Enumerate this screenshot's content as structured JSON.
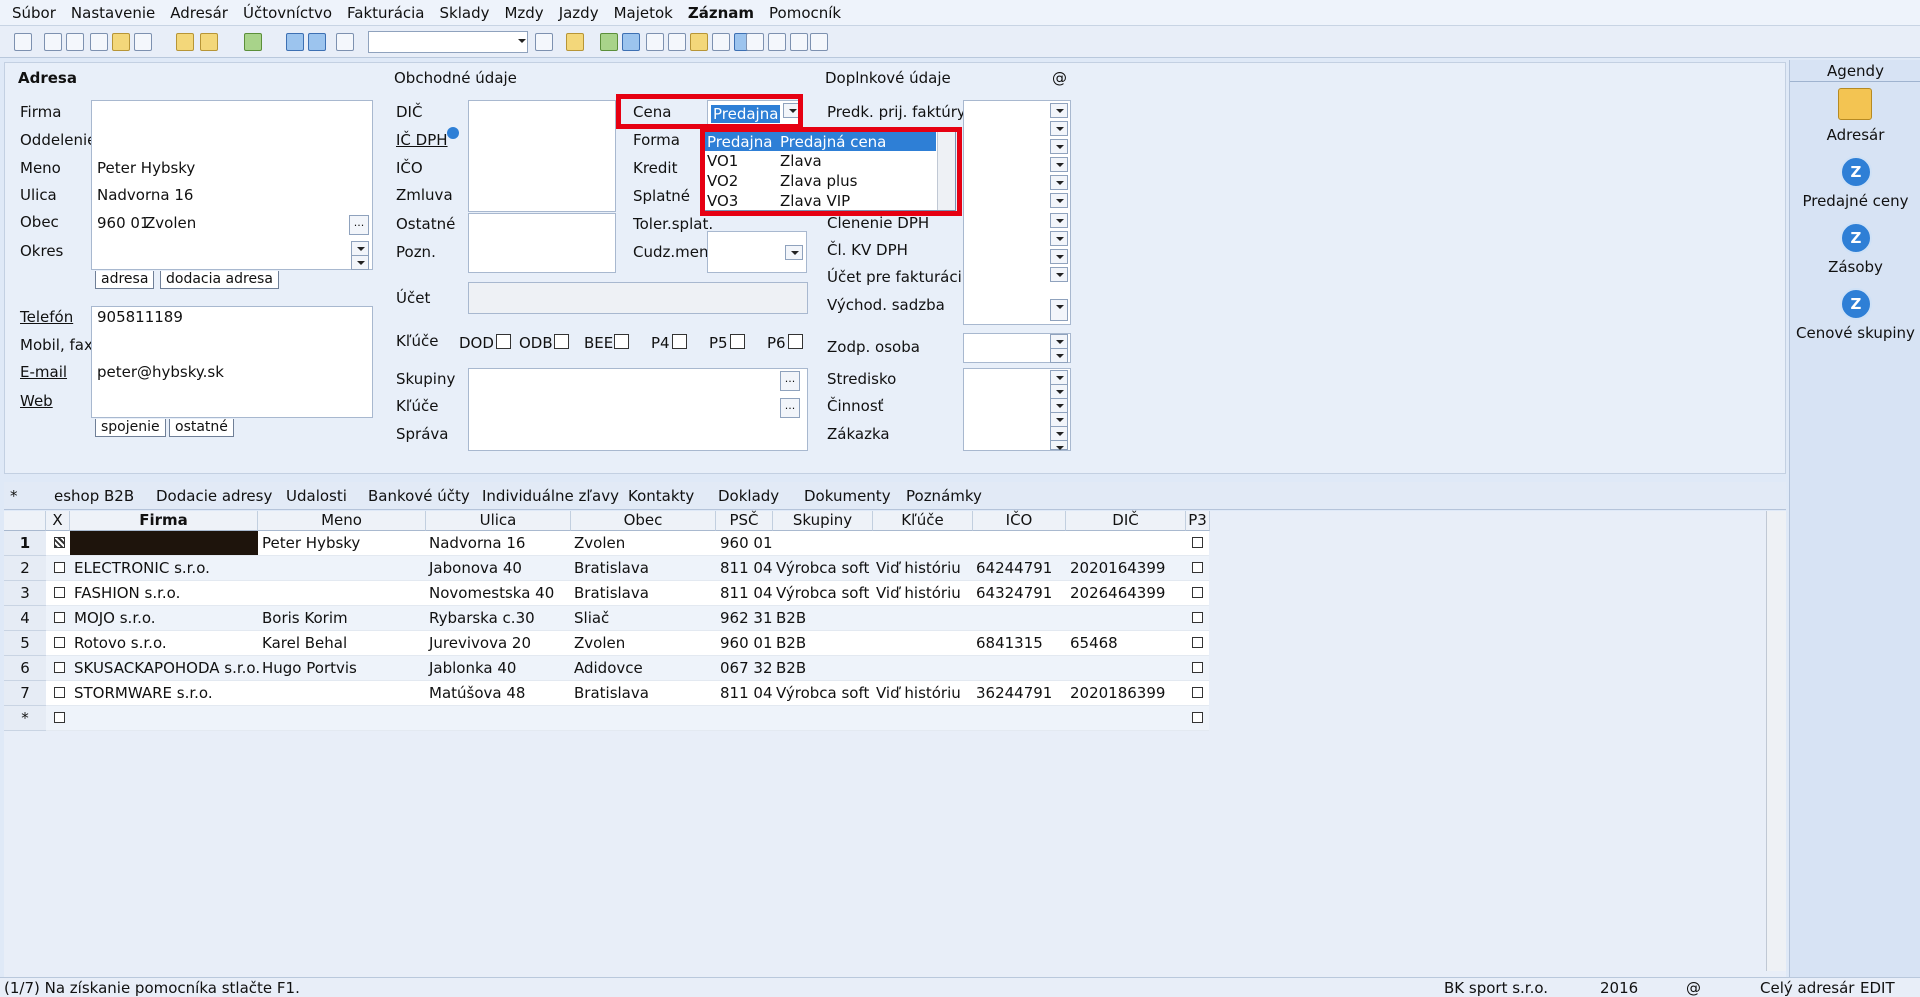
{
  "menu": [
    "Súbor",
    "Nastavenie",
    "Adresár",
    "Účtovníctvo",
    "Fakturácia",
    "Sklady",
    "Mzdy",
    "Jazdy",
    "Majetok",
    "Záznam",
    "Pomocník"
  ],
  "adresa": {
    "heading": "Adresa",
    "firma": "Firma",
    "oddelenie": "Oddelenie",
    "meno": "Meno",
    "ulica": "Ulica",
    "obec": "Obec",
    "okres": "Okres",
    "meno_val": "Peter Hybsky",
    "ulica_val": "Nadvorna 16",
    "psc_val": "960 01",
    "obec_val": "Zvolen",
    "tab1": "adresa",
    "tab2": "dodacia adresa",
    "telefon": "Telefón",
    "mobil": "Mobil, fax",
    "email": "E-mail",
    "web": "Web",
    "telefon_val": "905811189",
    "email_val": "peter@hybsky.sk",
    "tab3": "spojenie",
    "tab4": "ostatné"
  },
  "obchodne": {
    "heading": "Obchodné údaje",
    "dic": "DIČ",
    "icdph": "IČ DPH",
    "ico": "IČO",
    "zmluva": "Zmluva",
    "ostatne": "Ostatné",
    "pozn": "Pozn.",
    "ucet": "Účet",
    "kluce": "Kľúče",
    "dod": "DOD",
    "odb": "ODB",
    "bee": "BEE",
    "p4": "P4",
    "p5": "P5",
    "p6": "P6",
    "skupiny": "Skupiny",
    "kluce2": "Kľúče",
    "sprava": "Správa"
  },
  "cena": {
    "cena": "Cena",
    "forma": "Forma",
    "kredit": "Kredit",
    "splatne": "Splatné",
    "toler": "Toler.splat.",
    "cudz": "Cudz.mena",
    "selected": "Predajna",
    "options": [
      {
        "code": "Predajna",
        "name": "Predajná cena"
      },
      {
        "code": "VO1",
        "name": "Zlava"
      },
      {
        "code": "VO2",
        "name": "Zlava plus"
      },
      {
        "code": "VO3",
        "name": "Zlava VIP"
      }
    ]
  },
  "doplnkove": {
    "heading": "Doplnkové údaje",
    "at": "@",
    "predk": "Predk. prij. faktúry",
    "clenenie": "Členenie DPH",
    "clkv": "Čl. KV DPH",
    "ucetfak": "Účet pre fakturáciu",
    "vychod": "Východ. sadzba",
    "zodp": "Zodp. osoba",
    "stredisko": "Stredisko",
    "cinnost": "Činnosť",
    "zakazka": "Zákazka"
  },
  "agendy": {
    "title": "Agendy",
    "items": [
      "Adresár",
      "Predajné ceny",
      "Zásoby",
      "Cenové skupiny"
    ]
  },
  "tabs": [
    "*",
    "eshop B2B",
    "Dodacie adresy",
    "Udalosti",
    "Bankové účty",
    "Individuálne zľavy",
    "Kontakty",
    "Doklady",
    "Dokumenty",
    "Poznámky"
  ],
  "grid": {
    "headers": [
      "X",
      "Firma",
      "Meno",
      "Ulica",
      "Obec",
      "PSČ",
      "Skupiny",
      "Kľúče",
      "IČO",
      "DIČ",
      "P3"
    ],
    "rows": [
      {
        "n": "1",
        "firma": "",
        "meno": "Peter Hybsky",
        "ulica": "Nadvorna 16",
        "obec": "Zvolen",
        "psc": "960 01",
        "skup": "",
        "kluc": "",
        "ico": "",
        "dic": ""
      },
      {
        "n": "2",
        "firma": "ELECTRONIC s.r.o.",
        "meno": "",
        "ulica": "Jabonova 40",
        "obec": "Bratislava",
        "psc": "811 04",
        "skup": "Výrobca soft",
        "kluc": "Viď históriu",
        "ico": "64244791",
        "dic": "2020164399"
      },
      {
        "n": "3",
        "firma": "FASHION s.r.o.",
        "meno": "",
        "ulica": "Novomestska 40",
        "obec": "Bratislava",
        "psc": "811 04",
        "skup": "Výrobca soft",
        "kluc": "Viď históriu",
        "ico": "64324791",
        "dic": "2026464399"
      },
      {
        "n": "4",
        "firma": "MOJO s.r.o.",
        "meno": "Boris Korim",
        "ulica": "Rybarska c.30",
        "obec": "Sliač",
        "psc": "962 31",
        "skup": "B2B",
        "kluc": "",
        "ico": "",
        "dic": ""
      },
      {
        "n": "5",
        "firma": "Rotovo s.r.o.",
        "meno": "Karel Behal",
        "ulica": "Jurevivova 20",
        "obec": "Zvolen",
        "psc": "960 01",
        "skup": "B2B",
        "kluc": "",
        "ico": "6841315",
        "dic": "65468"
      },
      {
        "n": "6",
        "firma": "SKUSACKAPOHODA s.r.o.",
        "meno": "Hugo Portvis",
        "ulica": "Jablonka 40",
        "obec": "Adidovce",
        "psc": "067 32",
        "skup": "B2B",
        "kluc": "",
        "ico": "",
        "dic": ""
      },
      {
        "n": "7",
        "firma": "STORMWARE s.r.o.",
        "meno": "",
        "ulica": "Matúšova 48",
        "obec": "Bratislava",
        "psc": "811 04",
        "skup": "Výrobca soft",
        "kluc": "Viď históriu",
        "ico": "36244791",
        "dic": "2020186399"
      },
      {
        "n": "*",
        "firma": "",
        "meno": "",
        "ulica": "",
        "obec": "",
        "psc": "",
        "skup": "",
        "kluc": "",
        "ico": "",
        "dic": ""
      }
    ]
  },
  "status": {
    "left": "(1/7) Na získanie pomocníka stlačte F1.",
    "company": "BK sport s.r.o.",
    "year": "2016",
    "at": "@",
    "scope": "Celý adresár",
    "mode": "EDIT"
  }
}
